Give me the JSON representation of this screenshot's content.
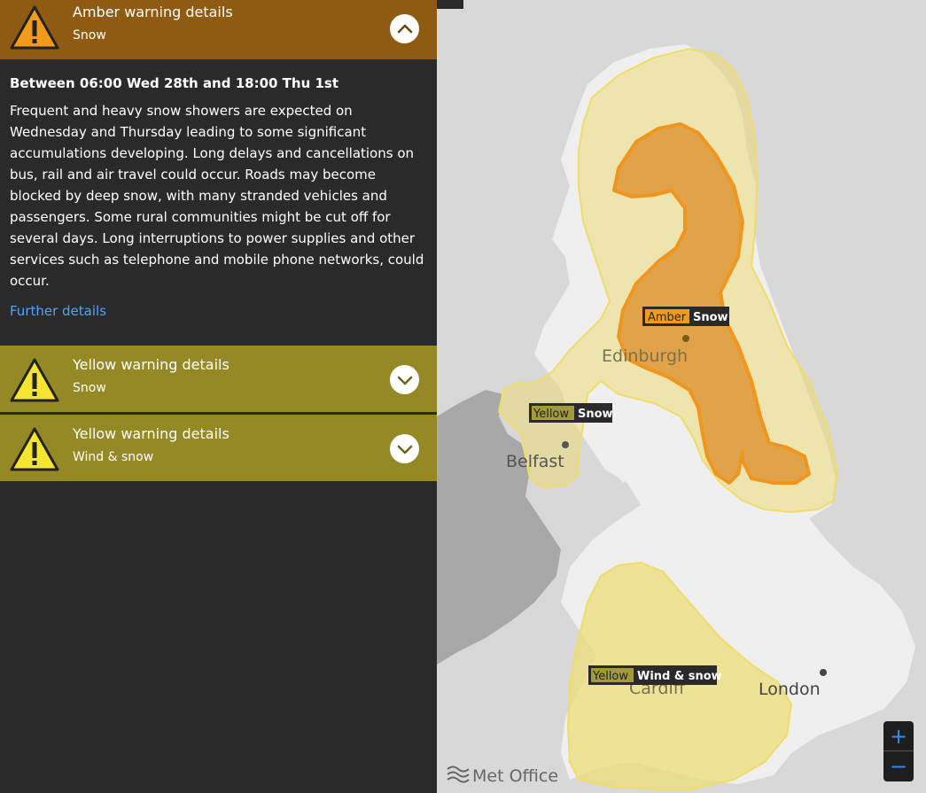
{
  "warnings": [
    {
      "title": "Amber warning details",
      "hazard": "Snow",
      "expanded": true,
      "color": "#8f5b13",
      "period": "Between 06:00 Wed 28th and 18:00 Thu 1st",
      "description": "Frequent and heavy snow showers are expected on Wednesday and Thursday leading to some significant accumulations developing. Long delays and cancellations on bus, rail and air travel could occur. Roads may become blocked by deep snow, with many stranded vehicles and passengers. Some rural communities might be cut off for several days. Long interruptions to power supplies and other services such as telephone and mobile phone networks, could occur.",
      "link": "Further details"
    },
    {
      "title": "Yellow warning details",
      "hazard": "Snow",
      "expanded": false,
      "color": "#958926"
    },
    {
      "title": "Yellow warning details",
      "hazard": "Wind & snow",
      "expanded": false,
      "color": "#958926"
    }
  ],
  "map": {
    "cities": [
      "Edinburgh",
      "Belfast",
      "Cardiff",
      "London"
    ],
    "labels": [
      {
        "level": "Amber",
        "hazard": "Snow",
        "color": "#f29a1a"
      },
      {
        "level": "Yellow",
        "hazard": "Snow",
        "color": "#a39a3a"
      },
      {
        "level": "Yellow",
        "hazard": "Wind & snow",
        "color": "#a39a3a"
      }
    ],
    "logo": "Met Office",
    "zoom_in": "+",
    "zoom_out": "−"
  }
}
